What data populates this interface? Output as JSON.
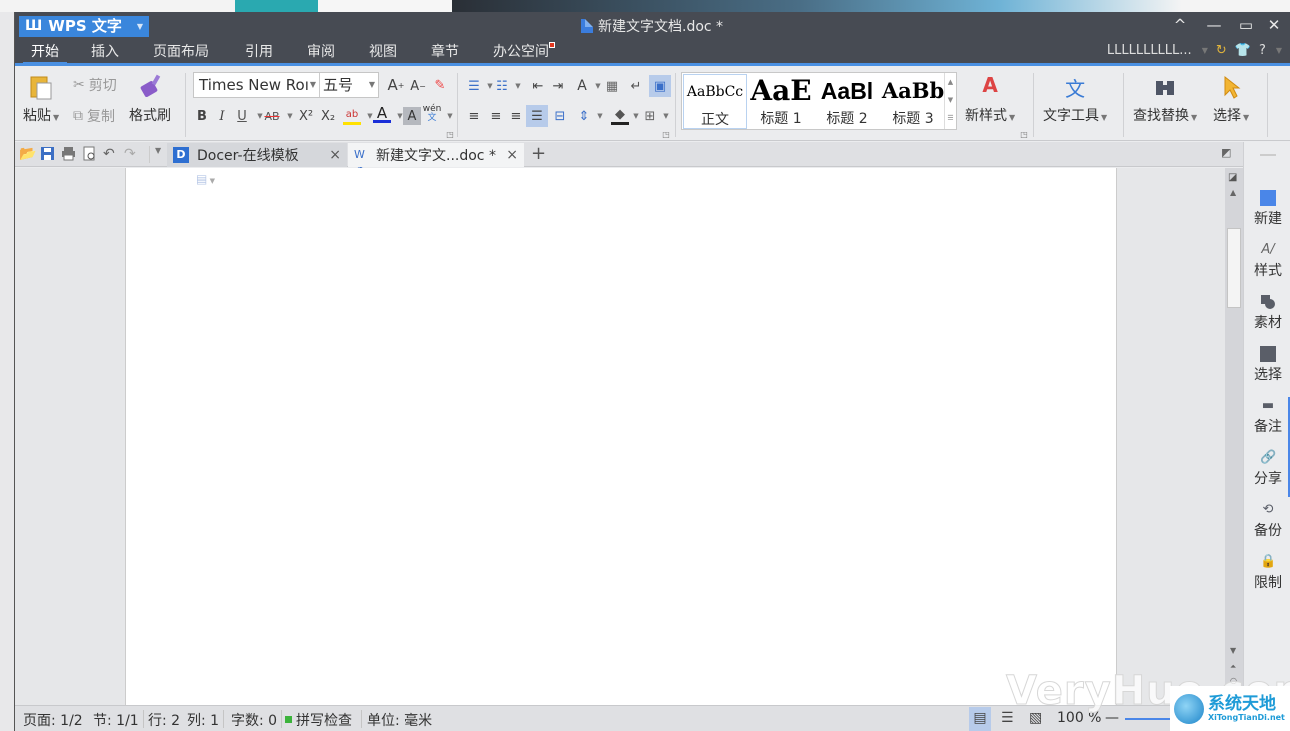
{
  "window": {
    "app_name": "WPS 文字",
    "document_title": "新建文字文档.doc *",
    "controls": {
      "collapse": "^",
      "minimize": "—",
      "maximize": "▭",
      "close": "✕"
    }
  },
  "menu": {
    "items": [
      "开始",
      "插入",
      "页面布局",
      "引用",
      "审阅",
      "视图",
      "章节",
      "办公空间"
    ],
    "active": "开始",
    "user_name": "LLLLLLLLLL...",
    "help": "?"
  },
  "ribbon": {
    "clipboard": {
      "paste": "粘贴",
      "cut": "剪切",
      "copy": "复制",
      "format_painter": "格式刷"
    },
    "font": {
      "name": "Times New Roman",
      "name_display": "Times New Roı",
      "size": "五号",
      "bold": "B",
      "italic": "I",
      "underline": "U",
      "strike": "AB",
      "superscript": "X²",
      "subscript": "X₂",
      "font_color": "A",
      "char_shading": "A",
      "phonetic": "wén 文"
    },
    "styles": [
      {
        "sample": "AaBbCc",
        "label": "正文"
      },
      {
        "sample": "AaE",
        "label": "标题 1"
      },
      {
        "sample": "AaBl",
        "label": "标题 2"
      },
      {
        "sample": "AaBb",
        "label": "标题 3"
      }
    ],
    "new_style": "新样式",
    "text_tools": "文字工具",
    "find_replace": "查找替换",
    "select": "选择"
  },
  "tabs": [
    {
      "label": "Docer-在线模板",
      "close": "×"
    },
    {
      "label": "新建文字文...doc *",
      "close": "×",
      "active": true
    }
  ],
  "new_tab": "+",
  "side_panel": [
    "新建",
    "样式",
    "素材",
    "选择",
    "备注",
    "分享",
    "备份",
    "限制"
  ],
  "status": {
    "page": "页面: 1/2",
    "section": "节: 1/1",
    "row": "行: 2",
    "col": "列: 1",
    "word_count": "字数: 0",
    "spell_check": "拼写检查",
    "unit": "单位: 毫米",
    "zoom": "100 %",
    "zoom_minus": "—"
  },
  "overlay": {
    "watermark": "VeryHuo.com",
    "logo_title": "系统天地",
    "logo_url": "XiTongTianDi.net"
  },
  "colors": {
    "accent": "#4a90e2",
    "titlebar": "#474b53",
    "app_button": "#3a86dc"
  }
}
